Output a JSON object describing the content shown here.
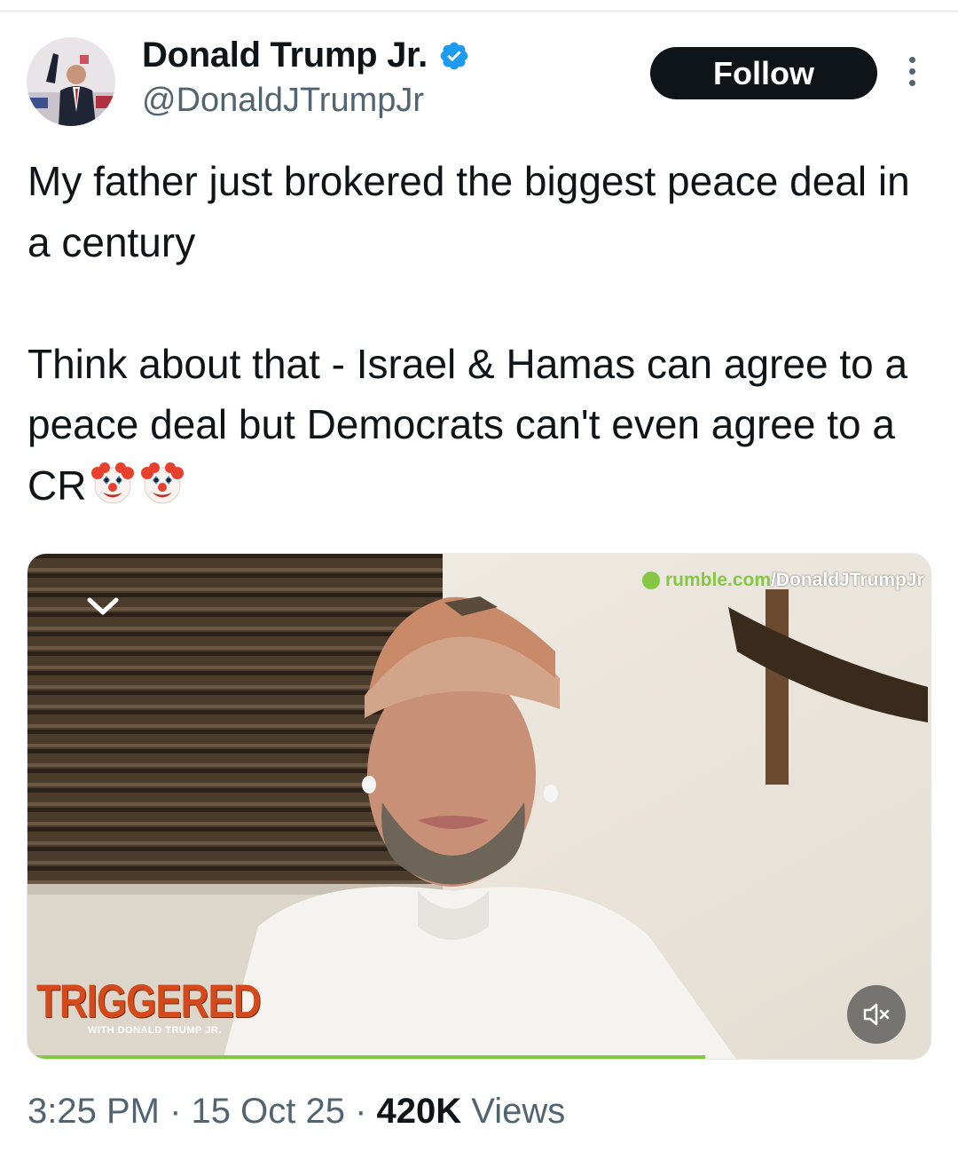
{
  "author": {
    "display_name": "Donald Trump Jr.",
    "handle": "@DonaldJTrumpJr",
    "verified_color": "#1d9bf0"
  },
  "actions": {
    "follow_label": "Follow",
    "more_icon": "more-vertical-icon"
  },
  "tweet": {
    "paragraph_1": "My father just brokered the biggest peace deal in a century",
    "paragraph_2": "Think about that - Israel & Hamas can agree to a peace deal but Democrats can't even agree to a CR",
    "emojis": [
      "clown-face",
      "clown-face"
    ]
  },
  "media": {
    "watermark_domain": "rumble.com",
    "watermark_path": "/DonaldJTrumpJr",
    "show_title": "TRIGGERED",
    "show_subtitle": "WITH DONALD TRUMP JR.",
    "progress_fraction": 0.75,
    "collapse_icon": "chevron-down-icon",
    "mute_icon": "volume-muted-icon",
    "accent_color": "#85c742"
  },
  "meta": {
    "time": "3:25 PM",
    "separator": " · ",
    "date": "15 Oct 25",
    "views_count": "420K",
    "views_label": " Views"
  }
}
